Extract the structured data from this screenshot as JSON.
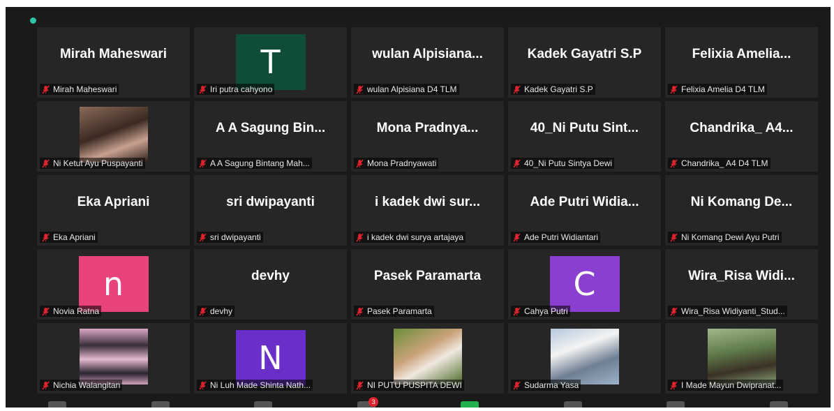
{
  "colors": {
    "tile_bg": "#262626",
    "muted_mic": "#e0232e",
    "status_dot": "#2ec4a6"
  },
  "participants": [
    {
      "display_name": "Mirah Maheswari",
      "tag": "Mirah Maheswari",
      "muted": true
    },
    {
      "avatar_letter": "T",
      "avatar_color": "#0f4d3a",
      "tag": "Iri putra cahyono",
      "muted": true
    },
    {
      "display_name": "wulan Alpisiana...",
      "tag": "wulan Alpisiana D4 TLM",
      "muted": true
    },
    {
      "display_name": "Kadek Gayatri S.P",
      "tag": "Kadek Gayatri S.P",
      "muted": true
    },
    {
      "display_name": "Felixia Amelia...",
      "tag": "Felixia Amelia D4 TLM",
      "muted": true
    },
    {
      "photo": "portrait-woman-dark-hair",
      "tag": "Ni Ketut Ayu Puspayanti",
      "muted": true
    },
    {
      "display_name": "A A Sagung Bin...",
      "tag": "A A Sagung Bintang Mah...",
      "muted": true
    },
    {
      "display_name": "Mona Pradnya...",
      "tag": "Mona Pradnyawati",
      "muted": true
    },
    {
      "display_name": "40_Ni Putu Sint...",
      "tag": "40_Ni Putu Sintya Dewi",
      "muted": true
    },
    {
      "display_name": "Chandrika_ A4...",
      "tag": "Chandrika_ A4 D4 TLM",
      "muted": true
    },
    {
      "display_name": "Eka Apriani",
      "tag": "Eka Apriani",
      "muted": true
    },
    {
      "display_name": "sri dwipayanti",
      "tag": "sri dwipayanti",
      "muted": true
    },
    {
      "display_name": "i kadek dwi sur...",
      "tag": "i kadek dwi surya artajaya",
      "muted": true
    },
    {
      "display_name": "Ade Putri Widia...",
      "tag": "Ade Putri Widiantari",
      "muted": true
    },
    {
      "display_name": "Ni Komang De...",
      "tag": "Ni Komang Dewi Ayu Putri",
      "muted": true
    },
    {
      "avatar_letter": "n",
      "avatar_color": "#e8447a",
      "tag": "Novia Ratna",
      "muted": true
    },
    {
      "display_name": "devhy",
      "tag": "devhy",
      "muted": true
    },
    {
      "display_name": "Pasek Paramarta",
      "tag": "Pasek Paramarta",
      "muted": true
    },
    {
      "avatar_letter": "C",
      "avatar_color": "#8a3fd1",
      "tag": "Cahya Putri",
      "muted": true
    },
    {
      "display_name": "Wira_Risa Widi...",
      "tag": "Wira_Risa Widiyanti_Stud...",
      "muted": true
    },
    {
      "photo": "portrait-collage-pink",
      "tag": "Nichia Walangitan",
      "muted": true
    },
    {
      "avatar_letter": "N",
      "avatar_color": "#6a2fc9",
      "tag": "Ni Luh Made Shinta Nath...",
      "muted": true
    },
    {
      "photo": "portrait-girl-with-pet",
      "tag": "NI PUTU PUSPITA DEWI",
      "muted": true
    },
    {
      "photo": "portrait-person-white-cap",
      "tag": "Sudarma Yasa",
      "muted": true
    },
    {
      "photo": "portrait-man-outdoors",
      "tag": "I Made Mayun Dwipranat...",
      "muted": true
    }
  ],
  "toolbar": {
    "chat_badge": "3"
  }
}
